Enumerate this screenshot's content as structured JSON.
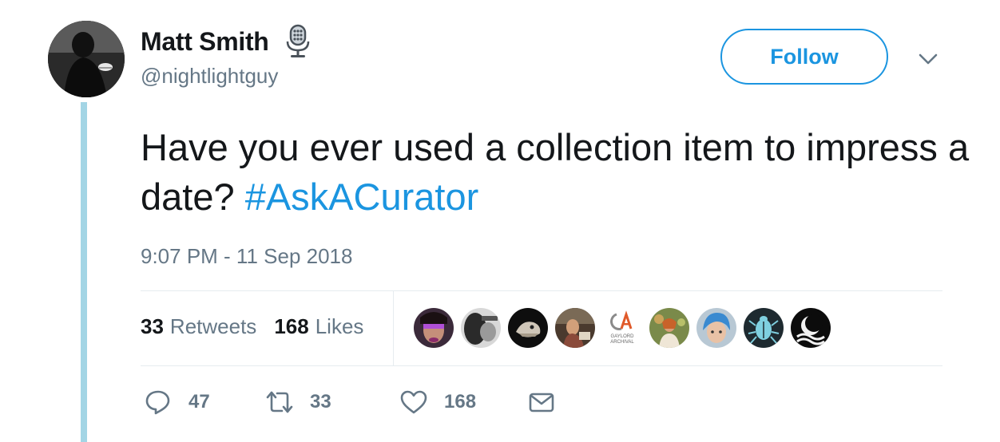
{
  "tweet": {
    "author": {
      "display_name": "Matt Smith",
      "handle": "@nightlightguy",
      "badge_icon": "microphone-icon"
    },
    "follow_label": "Follow",
    "text": "Have you ever used a collection item to impress a date? ",
    "hashtag": "#AskACurator",
    "timestamp": "9:07 PM - 11 Sep 2018",
    "stats": {
      "retweets_count": "33",
      "retweets_label": "Retweets",
      "likes_count": "168",
      "likes_label": "Likes"
    },
    "likers": [
      {
        "name": "liker-avatar-1"
      },
      {
        "name": "liker-avatar-2"
      },
      {
        "name": "liker-avatar-3"
      },
      {
        "name": "liker-avatar-4"
      },
      {
        "name": "liker-avatar-gaylord-archival",
        "logo_text": "GAYLORD ARCHIVAL"
      },
      {
        "name": "liker-avatar-6"
      },
      {
        "name": "liker-avatar-7"
      },
      {
        "name": "liker-avatar-8"
      },
      {
        "name": "liker-avatar-9"
      }
    ],
    "actions": {
      "reply_count": "47",
      "retweet_count": "33",
      "like_count": "168"
    }
  },
  "colors": {
    "accent": "#1b95e0",
    "thread_line": "#a3d5e5",
    "secondary_text": "#657786",
    "primary_text": "#14171a",
    "divider": "#e6ecf0"
  }
}
